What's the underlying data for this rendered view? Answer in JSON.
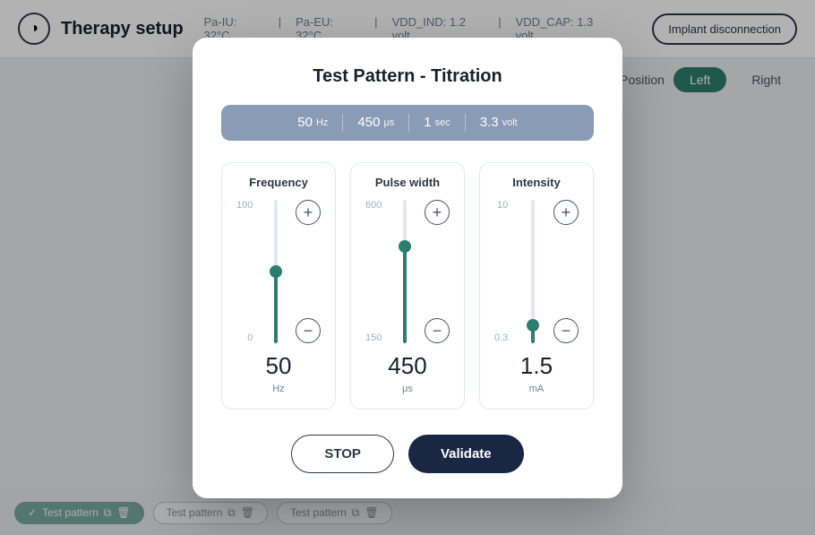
{
  "header": {
    "title": "Therapy setup",
    "logo_symbol": "◑",
    "stats": {
      "pa_iu": "Pa-IU: 32°C",
      "pa_eu": "Pa-EU: 32°C",
      "vdd_ind": "VDD_IND: 1.2 volt",
      "vdd_cap": "VDD_CAP: 1.3 volt",
      "separator1": "|",
      "separator2": "|",
      "separator3": "|"
    },
    "implant_button": "Implant disconnection"
  },
  "position": {
    "label": "Position",
    "left_btn": "Left",
    "right_btn": "Right",
    "active": "left"
  },
  "modal": {
    "title": "Test Pattern - Titration",
    "summary": {
      "frequency": {
        "value": "50",
        "unit": "Hz"
      },
      "pulse_width": {
        "value": "450",
        "unit": "μs"
      },
      "duration": {
        "value": "1",
        "unit": "sec"
      },
      "intensity": {
        "value": "3.3",
        "unit": "volt"
      }
    },
    "sliders": [
      {
        "id": "frequency",
        "label": "Frequency",
        "max": 100,
        "min": 0,
        "value": 50,
        "unit": "Hz",
        "fill_pct": 50,
        "thumb_pct": 50
      },
      {
        "id": "pulse_width",
        "label": "Pulse width",
        "max": 600,
        "min": 150,
        "value": 450,
        "unit": "μs",
        "fill_pct": 67,
        "thumb_pct": 67
      },
      {
        "id": "intensity",
        "label": "Intensity",
        "max": 10,
        "min": 0.3,
        "value": 1.5,
        "unit": "mA",
        "fill_pct": 12,
        "thumb_pct": 12
      }
    ],
    "stop_btn": "STOP",
    "validate_btn": "Validate"
  },
  "bottom_tabs": [
    {
      "label": "Test pattern",
      "active": true
    },
    {
      "label": "Test pattern",
      "active": false
    },
    {
      "label": "Test pattern",
      "active": false
    }
  ]
}
